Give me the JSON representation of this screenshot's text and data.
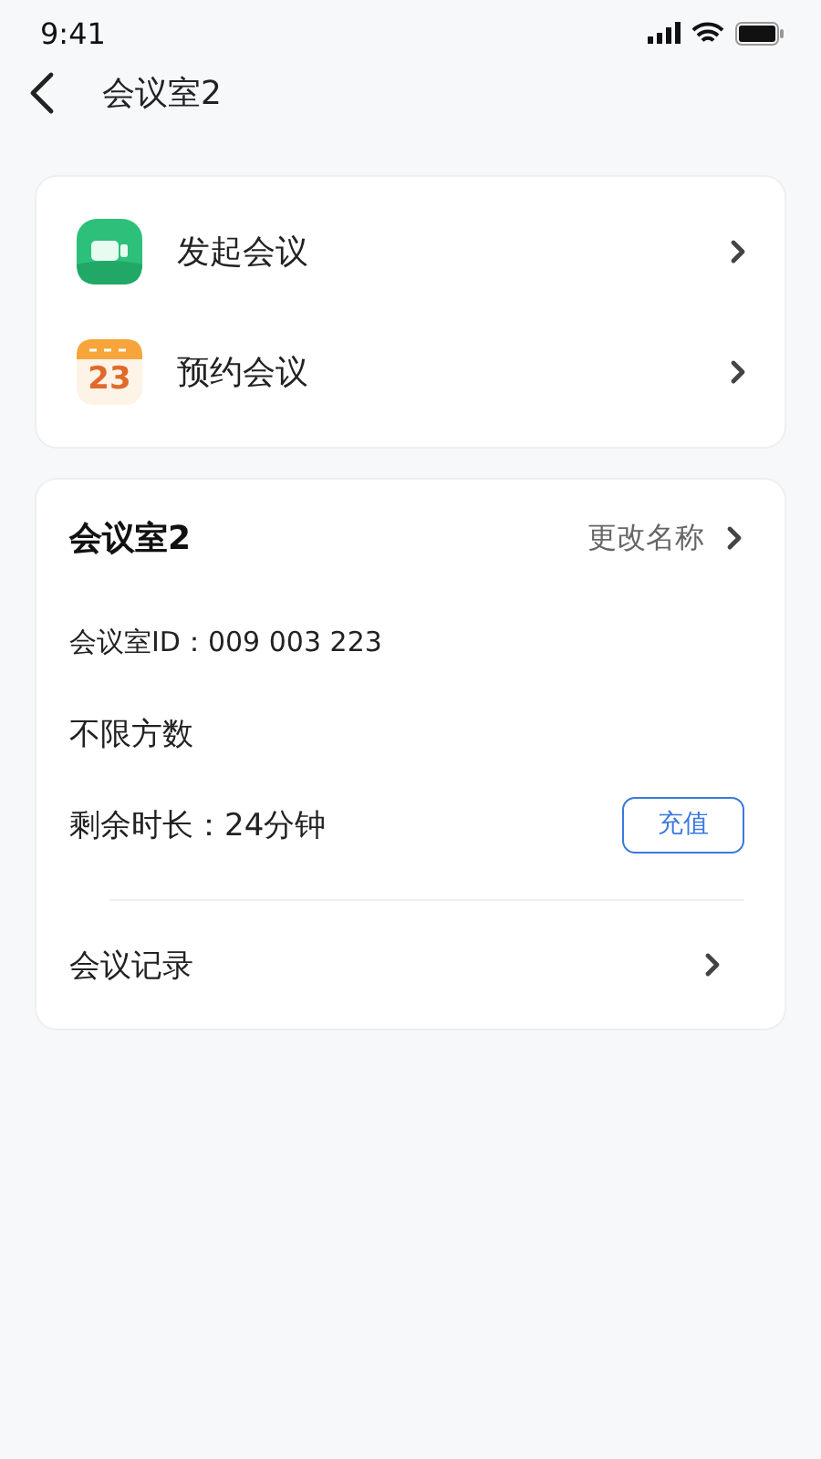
{
  "status_bar": {
    "time": "9:41"
  },
  "header": {
    "title": "会议室2"
  },
  "actions": [
    {
      "kind": "video",
      "label": "发起会议"
    },
    {
      "kind": "calendar",
      "label": "预约会议",
      "icon_text": "23"
    }
  ],
  "room": {
    "name": "会议室2",
    "rename": "更改名称",
    "id_line": "会议室ID：009 003 223",
    "capacity": "不限方数",
    "remaining": "剩余时长：24分钟",
    "recharge": "充值",
    "records": "会议记录"
  }
}
